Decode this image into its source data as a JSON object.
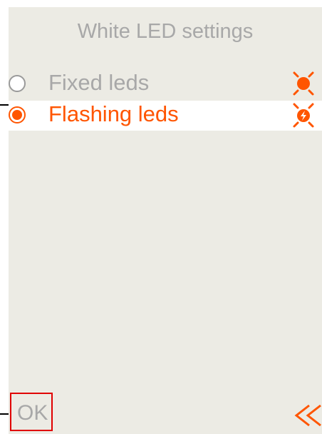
{
  "header": {
    "title": "White LED settings"
  },
  "options": [
    {
      "label": "Fixed leds",
      "selected": false,
      "icon": "led-fixed-icon"
    },
    {
      "label": "Flashing leds",
      "selected": true,
      "icon": "led-flashing-icon"
    }
  ],
  "footer": {
    "ok_label": "OK",
    "back_icon": "back-icon"
  },
  "colors": {
    "accent": "#ff5500",
    "text_muted": "#a8a8a8",
    "background": "#ecebe4",
    "selected_row": "#ffffff",
    "ok_border": "#e00000"
  }
}
